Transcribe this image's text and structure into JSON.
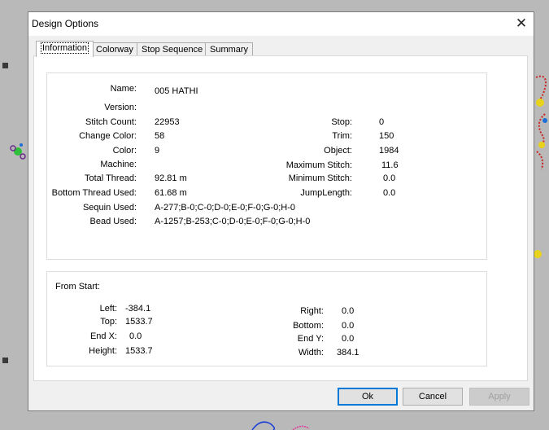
{
  "window": {
    "title": "Design Options"
  },
  "tabs": [
    "Information",
    "Colorway",
    "Stop Sequence",
    "Summary"
  ],
  "info": {
    "left_fields": [
      {
        "label": "Name:",
        "value": "005 HATHI"
      },
      {
        "label": "Version:",
        "value": ""
      },
      {
        "label": "Stitch Count:",
        "value": "22953"
      },
      {
        "label": "Change Color:",
        "value": "58"
      },
      {
        "label": "Color:",
        "value": "9"
      },
      {
        "label": "Machine:",
        "value": ""
      },
      {
        "label": "Total Thread:",
        "value": "92.81 m"
      },
      {
        "label": "Bottom Thread Used:",
        "value": "61.68 m"
      },
      {
        "label": "Sequin Used:",
        "value": "A-277;B-0;C-0;D-0;E-0;F-0;G-0;H-0"
      },
      {
        "label": "Bead Used:",
        "value": "A-1257;B-253;C-0;D-0;E-0;F-0;G-0;H-0"
      }
    ],
    "right_fields": [
      {
        "label": "Stop:",
        "value": "0"
      },
      {
        "label": "Trim:",
        "value": "150"
      },
      {
        "label": "Object:",
        "value": "1984"
      },
      {
        "label": "Maximum Stitch:",
        "value": "11.6"
      },
      {
        "label": "Minimum Stitch:",
        "value": "0.0"
      },
      {
        "label": "JumpLength:",
        "value": "0.0"
      }
    ]
  },
  "from_start": {
    "heading": "From Start:",
    "left_fields": [
      {
        "label": "Left:",
        "value": "-384.1"
      },
      {
        "label": "Top:",
        "value": "1533.7"
      },
      {
        "label": "End X:",
        "value": "0.0"
      },
      {
        "label": "Height:",
        "value": "1533.7"
      }
    ],
    "right_fields": [
      {
        "label": "Right:",
        "value": "0.0"
      },
      {
        "label": "Bottom:",
        "value": "0.0"
      },
      {
        "label": "End Y:",
        "value": "0.0"
      },
      {
        "label": "Width:",
        "value": "384.1"
      }
    ]
  },
  "buttons": {
    "ok": "Ok",
    "cancel": "Cancel",
    "apply": "Apply"
  },
  "colors": {
    "accent": "#0078d7",
    "background": "#b9b9b9"
  }
}
